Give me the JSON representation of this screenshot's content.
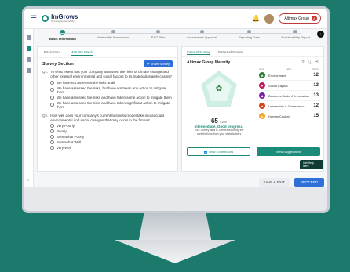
{
  "app": {
    "brand": "ImGrows",
    "tagline": "Growing Sustainability"
  },
  "header": {
    "org_name": "Altimax Group",
    "org_badge": "A"
  },
  "steps": [
    {
      "label": "Basic Information",
      "active": true
    },
    {
      "label": "Materiality Assessment",
      "active": false
    },
    {
      "label": "ESG Plan",
      "active": false
    },
    {
      "label": "Assessment Approval",
      "active": false
    },
    {
      "label": "Reporting Data",
      "active": false
    },
    {
      "label": "Sustainability Report",
      "active": false
    }
  ],
  "left": {
    "tabs": [
      "Basic Info",
      "Maturity Matrix"
    ],
    "section_title": "Survey Section",
    "share_label": "Share Survey",
    "questions": [
      {
        "num": "Q1.",
        "text": "To what extent has your company assessed the risks of climate change and other external environmental and social factors to its materials supply chains?",
        "options": [
          "We have not assessed the risks at all",
          "We have assessed the risks, but have not taken any action to mitigate them",
          "We have assessed the risks and have taken some action to mitigate them",
          "We have assessed the risks and have taken significant action to mitigate them"
        ]
      },
      {
        "num": "Q2.",
        "text": "How well does your company's current business model take into account environmental and social changes that may occur in the future?",
        "options": [
          "Very Poorly",
          "Poorly",
          "Somewhat Poorly",
          "Somewhat Well",
          "Very Well"
        ]
      }
    ]
  },
  "right": {
    "tabs": [
      "Internal Survey",
      "External Survey"
    ],
    "title": "Altimax Group Maturity",
    "score": "65",
    "score_max": "/ 100",
    "level": "Intermediate, Good progress.",
    "desc": "Your Survey data is Generated using the contributions from your stakeholders",
    "topic_header": {
      "type": "Topic",
      "label": "Label",
      "score": "Score"
    },
    "topics": [
      {
        "label": "Environment",
        "value": "12",
        "color": "#2e7d32"
      },
      {
        "label": "Social Capital",
        "value": "13",
        "color": "#c2185b"
      },
      {
        "label": "Business Model & Innovation",
        "value": "13",
        "color": "#7b1fa2"
      },
      {
        "label": "Leadership & Governance",
        "value": "12",
        "color": "#d84315"
      },
      {
        "label": "Human Capital",
        "value": "15",
        "color": "#f9a825"
      }
    ],
    "view_contributors": "View Contributors",
    "view_suggestions": "View Suggestions",
    "tooltip": "Get Help Here"
  },
  "footer": {
    "save_label": "SAVE & EXIT",
    "proceed_label": "PROCEED"
  }
}
